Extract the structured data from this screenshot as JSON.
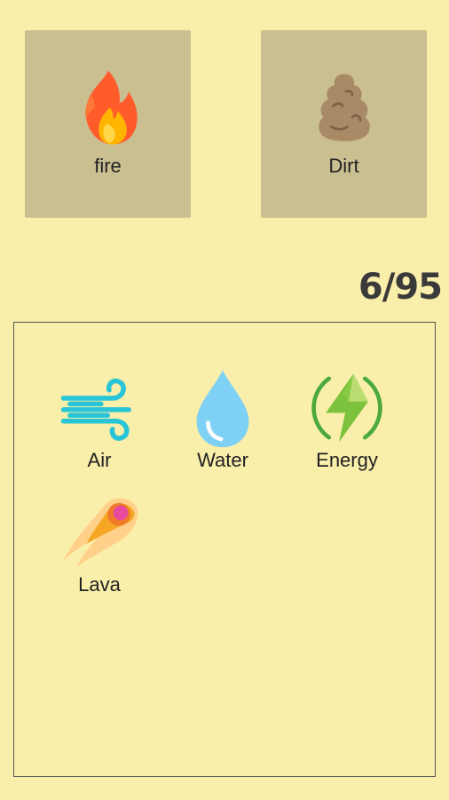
{
  "slots": {
    "left": {
      "label": "fire",
      "icon": "fire-icon"
    },
    "right": {
      "label": "Dirt",
      "icon": "dirt-icon"
    }
  },
  "counter": {
    "text": "6/95"
  },
  "inventory": {
    "items": [
      {
        "label": "Air",
        "icon": "wind-icon"
      },
      {
        "label": "Water",
        "icon": "water-drop-icon"
      },
      {
        "label": "Energy",
        "icon": "lightning-icon"
      },
      {
        "label": "Lava",
        "icon": "comet-icon"
      }
    ]
  },
  "colors": {
    "background": "#f9eeaa",
    "slot_background": "#cabf91",
    "text": "#222222"
  }
}
